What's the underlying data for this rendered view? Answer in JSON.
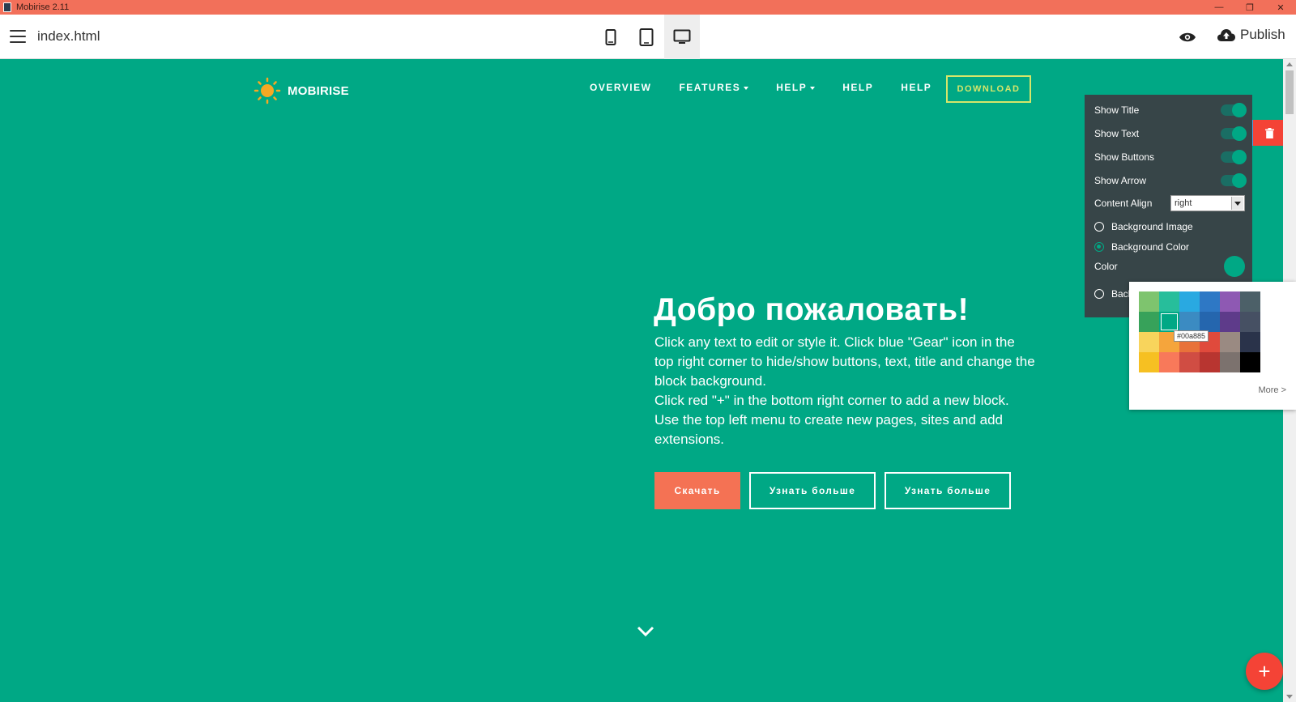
{
  "window": {
    "title": "Mobirise 2.11",
    "min_label": "—",
    "restore_label": "❐",
    "close_label": "✕"
  },
  "toolbar": {
    "doc_title": "index.html",
    "publish_label": "Publish"
  },
  "site": {
    "brand": "MOBIRISE",
    "nav": [
      "OVERVIEW",
      "FEATURES",
      "HELP",
      "HELP",
      "HELP"
    ],
    "download_label": "DOWNLOAD"
  },
  "hero": {
    "title": "Добро пожаловать!",
    "paragraphs": [
      "Click any text to edit or style it. Click blue \"Gear\" icon in the top right corner to hide/show buttons, text, title and change the block background.",
      "Click red \"+\" in the bottom right corner to add a new block. Use the top left menu to create new pages, sites and add extensions."
    ],
    "buttons": [
      "Скачать",
      "Узнать больше",
      "Узнать больше"
    ]
  },
  "settings": {
    "show_title": "Show Title",
    "show_text": "Show Text",
    "show_buttons": "Show Buttons",
    "show_arrow": "Show Arrow",
    "content_align_label": "Content Align",
    "content_align_value": "right",
    "bg_image": "Background Image",
    "bg_color": "Background Color",
    "color_label": "Color",
    "bg_video_partial": "Back"
  },
  "palette": {
    "tooltip": "#00a885",
    "more_label": "More >",
    "colors": [
      "#7ec46e",
      "#27be9b",
      "#29a9e1",
      "#2e78c5",
      "#8e59b3",
      "#4c6068",
      "#37a25a",
      "#00a885",
      "#3b8bc2",
      "#2566ae",
      "#5e3b8a",
      "#465063",
      "#f8d45c",
      "#f5a53c",
      "#e8723a",
      "#e04a3c",
      "#9a8a82",
      "#2a334a",
      "#f6c022",
      "#f8795a",
      "#d04d43",
      "#b83530",
      "#7c726e",
      "#000000"
    ],
    "right_col": [
      "#eeeeee",
      "#eeeeee",
      "#d0d0d0",
      "#c2c2c2"
    ]
  },
  "colors": {
    "canvas": "#00a885",
    "title_bar": "#f2705a",
    "accent_blue": "#48a3e8",
    "danger": "#f44336"
  }
}
